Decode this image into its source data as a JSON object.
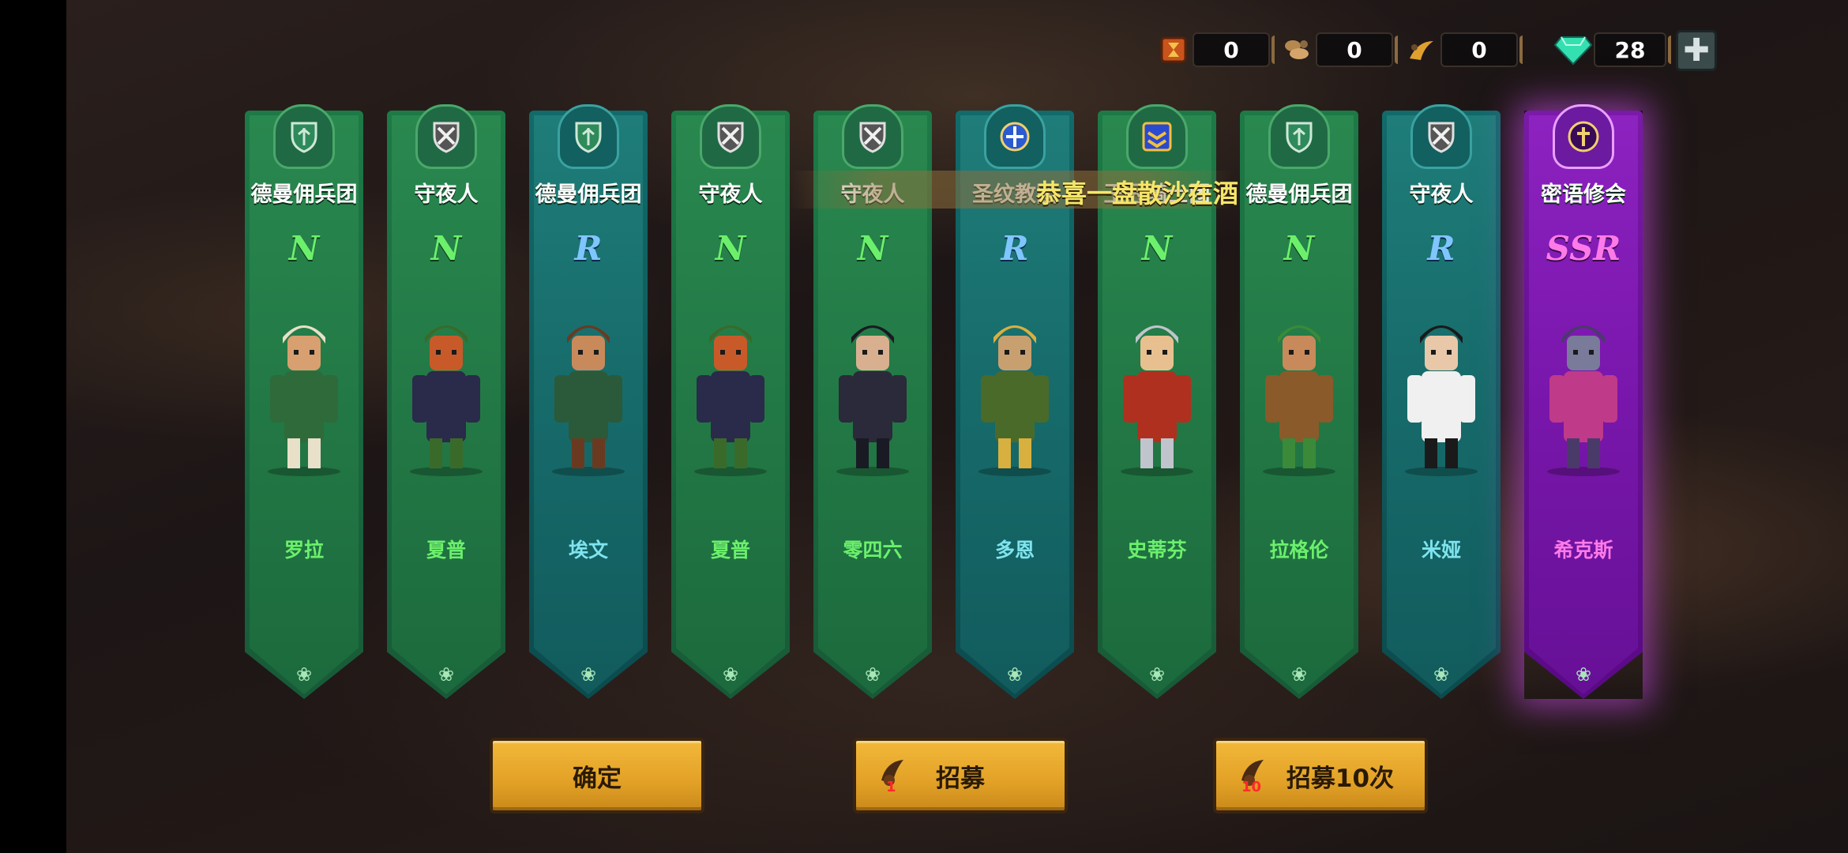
{
  "resources": [
    {
      "icon": "hourglass-token-icon",
      "value": "0"
    },
    {
      "icon": "wood-material-icon",
      "value": "0"
    },
    {
      "icon": "horn-material-icon",
      "value": "0"
    },
    {
      "icon": "diamond-gem-icon",
      "value": "28"
    }
  ],
  "plus_label": "✚",
  "banner": "恭喜一盘散沙在酒",
  "cards": [
    {
      "faction": "德曼佣兵团",
      "rarity": "N",
      "name": "罗拉",
      "theme": "green",
      "emblem": "shield-leaf-icon"
    },
    {
      "faction": "守夜人",
      "rarity": "N",
      "name": "夏普",
      "theme": "green",
      "emblem": "crossed-swords-icon"
    },
    {
      "faction": "德曼佣兵团",
      "rarity": "R",
      "name": "埃文",
      "theme": "teal",
      "emblem": "shield-leaf-icon"
    },
    {
      "faction": "守夜人",
      "rarity": "N",
      "name": "夏普",
      "theme": "green",
      "emblem": "crossed-swords-icon"
    },
    {
      "faction": "守夜人",
      "rarity": "N",
      "name": "零四六",
      "theme": "green",
      "emblem": "crossed-swords-icon"
    },
    {
      "faction": "圣纹教团",
      "rarity": "R",
      "name": "多恩",
      "theme": "teal",
      "emblem": "holy-crest-icon"
    },
    {
      "faction": "王冠骑士团",
      "rarity": "N",
      "name": "史蒂芬",
      "theme": "green",
      "emblem": "chevron-rank-icon"
    },
    {
      "faction": "德曼佣兵团",
      "rarity": "N",
      "name": "拉格伦",
      "theme": "green",
      "emblem": "shield-leaf-icon"
    },
    {
      "faction": "守夜人",
      "rarity": "R",
      "name": "米娅",
      "theme": "teal",
      "emblem": "crossed-swords-icon"
    },
    {
      "faction": "密语修会",
      "rarity": "SSR",
      "name": "希克斯",
      "theme": "purple",
      "emblem": "cross-shield-icon"
    }
  ],
  "buttons": {
    "confirm": "确定",
    "recruit": "招募",
    "recruit_count_single": "1",
    "recruit10": "招募10次",
    "recruit_count_ten": "10"
  },
  "colors": {
    "green_card": "#29884f",
    "teal_card": "#1f7d79",
    "purple_card": "#8d22c0",
    "button": "#e2a126",
    "rarity_n": "#6cf06c",
    "rarity_r": "#7fc6ff",
    "rarity_ssr": "#ff7ae9"
  }
}
